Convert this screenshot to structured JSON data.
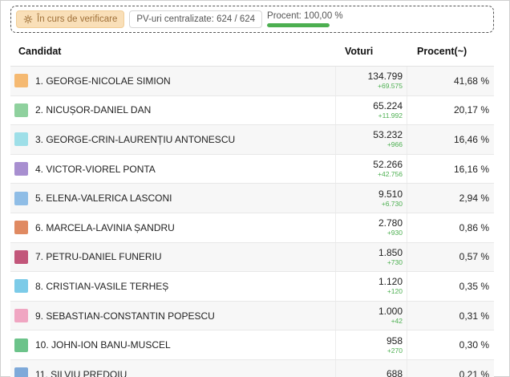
{
  "status": {
    "verify_label": "În curs de verificare",
    "pv_label": "PV-uri centralizate: 624 / 624",
    "progress_label": "Procent: 100,00 %",
    "progress_fraction": 1.0
  },
  "table": {
    "headers": {
      "candidate": "Candidat",
      "votes": "Voturi",
      "percent": "Procent(~)"
    },
    "rows": [
      {
        "name": "1. GEORGE-NICOLAE SIMION",
        "votes": "134.799",
        "delta": "+69.575",
        "percent": "41,68 %",
        "color": "#f5b971"
      },
      {
        "name": "2. NICUȘOR-DANIEL DAN",
        "votes": "65.224",
        "delta": "+11.992",
        "percent": "20,17 %",
        "color": "#8fd19e"
      },
      {
        "name": "3. GEORGE-CRIN-LAURENȚIU ANTONESCU",
        "votes": "53.232",
        "delta": "+966",
        "percent": "16,46 %",
        "color": "#9edfe8"
      },
      {
        "name": "4. VICTOR-VIOREL PONTA",
        "votes": "52.266",
        "delta": "+42.756",
        "percent": "16,16 %",
        "color": "#a88fd0"
      },
      {
        "name": "5. ELENA-VALERICA LASCONI",
        "votes": "9.510",
        "delta": "+6.730",
        "percent": "2,94 %",
        "color": "#8fbde6"
      },
      {
        "name": "6. MARCELA-LAVINIA ȘANDRU",
        "votes": "2.780",
        "delta": "+930",
        "percent": "0,86 %",
        "color": "#e08a62"
      },
      {
        "name": "7. PETRU-DANIEL FUNERIU",
        "votes": "1.850",
        "delta": "+730",
        "percent": "0,57 %",
        "color": "#c2567a"
      },
      {
        "name": "8. CRISTIAN-VASILE TERHEȘ",
        "votes": "1.120",
        "delta": "+120",
        "percent": "0,35 %",
        "color": "#7ccbe8"
      },
      {
        "name": "9. SEBASTIAN-CONSTANTIN POPESCU",
        "votes": "1.000",
        "delta": "+42",
        "percent": "0,31 %",
        "color": "#f0a6c2"
      },
      {
        "name": "10. JOHN-ION BANU-MUSCEL",
        "votes": "958",
        "delta": "+270",
        "percent": "0,30 %",
        "color": "#6cc38a"
      },
      {
        "name": "11. SILVIU PREDOIU",
        "votes": "688",
        "delta": "",
        "percent": "0,21 %",
        "color": "#7ea9d9"
      }
    ]
  }
}
